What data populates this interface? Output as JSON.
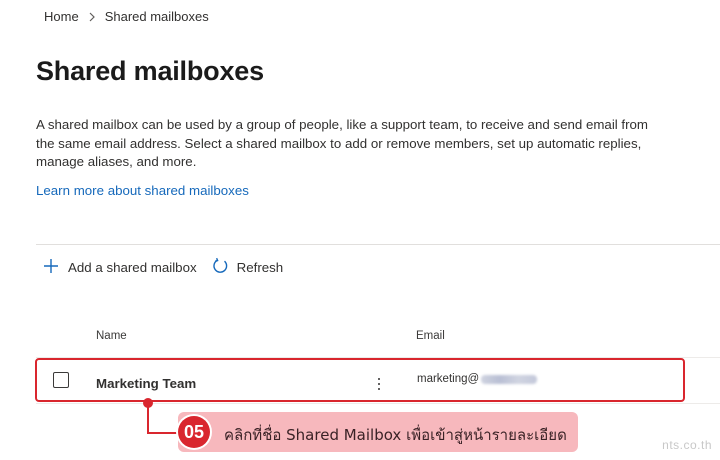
{
  "breadcrumb": {
    "home": "Home",
    "current": "Shared mailboxes"
  },
  "page": {
    "title": "Shared mailboxes",
    "description": "A shared mailbox can be used by a group of people, like a support team, to receive and send email from the same email address. Select a shared mailbox to add or remove members, set up automatic replies, manage aliases, and more.",
    "learn_more": "Learn more about shared mailboxes"
  },
  "toolbar": {
    "add_label": "Add a shared mailbox",
    "refresh_label": "Refresh"
  },
  "table": {
    "columns": {
      "name": "Name",
      "email": "Email"
    },
    "rows": [
      {
        "name": "Marketing Team",
        "email_prefix": "marketing@"
      }
    ]
  },
  "callout": {
    "step": "05",
    "text": "คลิกที่ชื่อ Shared Mailbox เพื่อเข้าสู่หน้ารายละเอียด"
  },
  "watermark": "nts.co.th",
  "colors": {
    "accent": "#1669bb",
    "highlight": "#d9262e",
    "callout_bg": "#f7b8bd"
  }
}
